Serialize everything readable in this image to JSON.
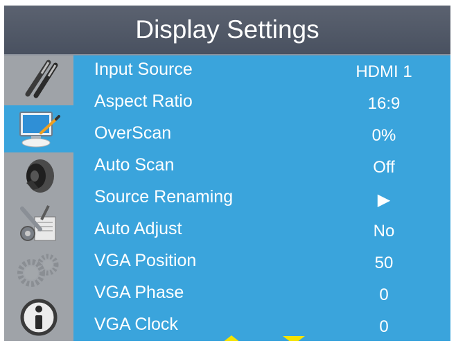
{
  "title": "Display Settings",
  "sidebar": {
    "items": [
      {
        "icon": "brushes-icon"
      },
      {
        "icon": "monitor-icon",
        "active": true
      },
      {
        "icon": "speaker-icon"
      },
      {
        "icon": "tools-icon"
      },
      {
        "icon": "gears-icon"
      },
      {
        "icon": "info-icon"
      }
    ]
  },
  "menu": {
    "items": [
      {
        "label": "Input Source",
        "value": "HDMI 1"
      },
      {
        "label": "Aspect Ratio",
        "value": "16:9"
      },
      {
        "label": "OverScan",
        "value": "0%"
      },
      {
        "label": "Auto Scan",
        "value": "Off"
      },
      {
        "label": "Source Renaming",
        "value": "▶"
      },
      {
        "label": "Auto Adjust",
        "value": "No"
      },
      {
        "label": "VGA Position",
        "value": "50"
      },
      {
        "label": "VGA Phase",
        "value": "0"
      },
      {
        "label": "VGA Clock",
        "value": "0"
      }
    ]
  },
  "scroll": {
    "up_icon": "scroll-up-arrow-icon",
    "down_icon": "scroll-down-arrow-icon"
  },
  "colors": {
    "panel": "#3aa4dc",
    "title_bar": "#505866",
    "sidebar": "#9fa3a8",
    "arrows": "#f5e300"
  }
}
